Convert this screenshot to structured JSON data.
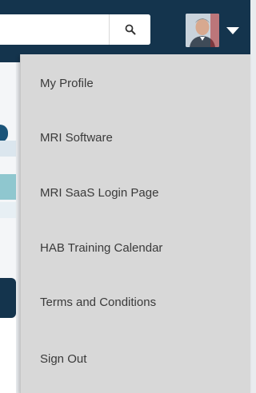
{
  "header": {
    "search": {
      "placeholder": "",
      "icon": "search-icon"
    },
    "user_menu": {
      "avatar": "user-avatar",
      "caret_icon": "caret-down-icon"
    }
  },
  "menu": {
    "items": [
      {
        "label": "My Profile"
      },
      {
        "label": "MRI Software"
      },
      {
        "label": "MRI SaaS Login Page"
      },
      {
        "label": "HAB Training Calendar"
      },
      {
        "label": "Terms and Conditions"
      },
      {
        "label": "Sign Out"
      }
    ]
  },
  "colors": {
    "header_bg": "#14344d",
    "menu_bg": "#d8d8d8",
    "menu_text": "#3a3a3a"
  }
}
